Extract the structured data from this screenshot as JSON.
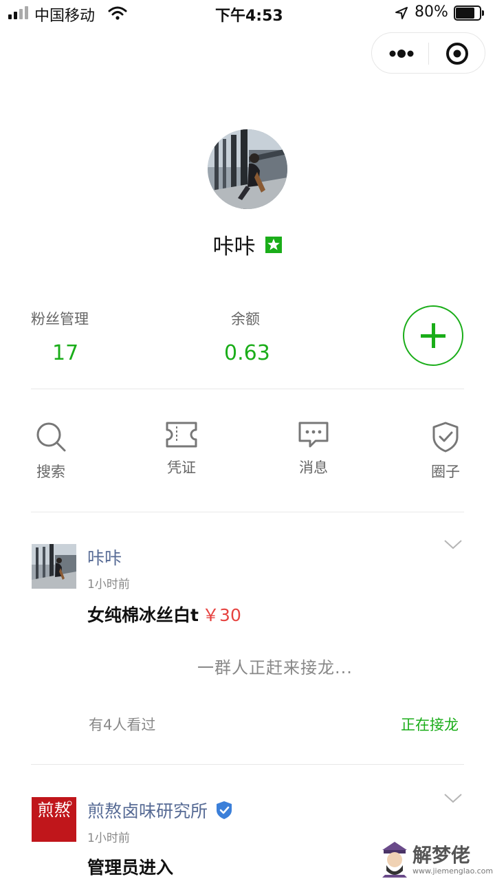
{
  "status_bar": {
    "carrier": "中国移动",
    "time": "下午4:53",
    "battery": "80%",
    "battery_level": 0.8
  },
  "profile": {
    "name": "咔咔"
  },
  "stats": [
    {
      "label": "粉丝管理",
      "value": "17"
    },
    {
      "label": "余额",
      "value": "0.63"
    }
  ],
  "menu": [
    {
      "label": "搜索",
      "icon": "search-icon"
    },
    {
      "label": "凭证",
      "icon": "ticket-icon"
    },
    {
      "label": "消息",
      "icon": "message-icon"
    },
    {
      "label": "圈子",
      "icon": "shield-check-icon"
    }
  ],
  "posts": [
    {
      "author": "咔咔",
      "time": "1小时前",
      "title": "女纯棉冰丝白t",
      "price": "￥30",
      "waiting": "一群人正赶来接龙...",
      "seen": "有4人看过",
      "status": "正在接龙"
    },
    {
      "author": "煎熬卤味研究所",
      "logo_text": "煎熬",
      "time": "1小时前",
      "title": "管理员进入"
    }
  ],
  "watermark": {
    "text": "解梦佬",
    "url": "www.jiemenglao.com"
  },
  "colors": {
    "accent": "#1aad19",
    "link": "#576b95",
    "price": "#e64340"
  }
}
